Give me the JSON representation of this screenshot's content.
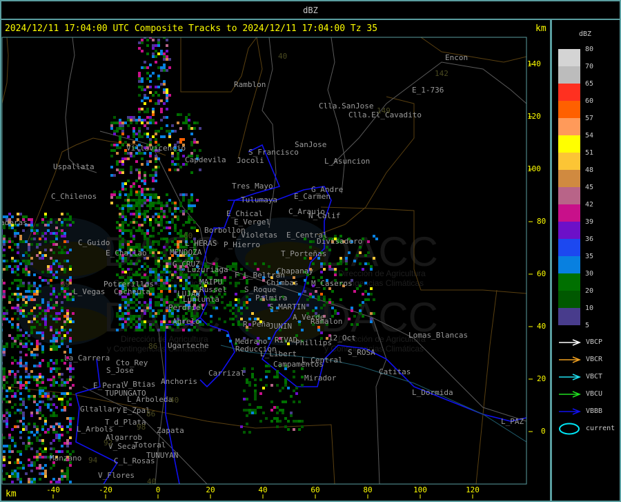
{
  "header": {
    "title": "dBZ"
  },
  "plot": {
    "title": "2024/12/11 17:04:00 UTC Composite Tracks to 2024/12/11 17:04:00 Tz 35",
    "y_unit": "km",
    "x_unit": "km",
    "x_ticks": [
      "-40",
      "-20",
      "0",
      "20",
      "40",
      "60",
      "80",
      "100",
      "120"
    ],
    "y_ticks": [
      "140",
      "120",
      "100",
      "80",
      "60",
      "40",
      "20",
      "0"
    ],
    "watermark": [
      "DACC",
      "Dirección de Agricultura",
      "y Contingencias Climáticas",
      "http://www.contingencias.mendoza.gov.ar"
    ]
  },
  "places": [
    "Ramblon",
    "Encon",
    "E_1-736",
    "Clla.SanJose",
    "Clla.El_Cavadito",
    "SanJose",
    "S_Francisco",
    "Jocoli",
    "L_Asuncion",
    "Villavicencio",
    "Capdevila",
    "Uspallata",
    "C_Chilenos",
    "Tres_Mayo",
    "G_Andre",
    "E_Carmen",
    "Tulumaya",
    "C_Araujo",
    "N_Calif",
    "E_Chical",
    "E_Vergel",
    "Borbollon",
    "L_Violetas",
    "E_Central",
    "Divisadero",
    "P_Hierro",
    "L_HERAS",
    "C_Guido",
    "E_Challao",
    "MENDOZA",
    "T_Porteñas",
    "G_CRUZ",
    "Luzuriaga",
    "Chapanay",
    "F_L_Beltran",
    "Potrerillos",
    "MAIPU",
    "Chimbas",
    "M_Caseros",
    "L_Vegas",
    "Cacheuta",
    "Russel",
    "S_Roque",
    "LUJAN",
    "Lunlunta",
    "Palmira",
    "S_MARTIN",
    "Perdriel",
    "A_Verde",
    "Ramalon",
    "Agrelo",
    "R_Peña",
    "JUNIN",
    "12_Oct",
    "Lomas_Blancas",
    "Medrano",
    "RIVAD",
    "Phillips",
    "Ugarteche",
    "Reduccion",
    "L_Libert",
    "S_ROSA",
    "La_Carrera",
    "Cto_Rey",
    "L_Central",
    "Campamentos",
    "S_Jose",
    "Carrizal",
    "Anchoris",
    "Catitas",
    "Mirador",
    "E_Peral",
    "V_Btias",
    "TUPUNGATO",
    "L_Dormida",
    "L_Arboleda",
    "Gltallary",
    "E_Zpal",
    "T_d_Plata",
    "L_Arbols",
    "Zapata",
    "L_PAZ",
    "Algarrob",
    "V_Seca",
    "Totoral",
    "Manzano",
    "C_L_Rosas",
    "TUNUYAN",
    "V_Flores",
    "aderas"
  ],
  "road_numbers": [
    "40",
    "142",
    "149",
    "7",
    "60",
    "89",
    "86",
    "40",
    "86",
    "98",
    "92",
    "94",
    "40"
  ],
  "legend": {
    "title": "dBZ",
    "scale": [
      {
        "label": "80",
        "color": "#d4d4d4"
      },
      {
        "label": "70",
        "color": "#bcbcbc"
      },
      {
        "label": "65",
        "color": "#ff3020"
      },
      {
        "label": "60",
        "color": "#ff6000"
      },
      {
        "label": "57",
        "color": "#ff9a5a"
      },
      {
        "label": "54",
        "color": "#ffff00"
      },
      {
        "label": "51",
        "color": "#fcc535"
      },
      {
        "label": "48",
        "color": "#d08a40"
      },
      {
        "label": "45",
        "color": "#b86488"
      },
      {
        "label": "42",
        "color": "#c8108a"
      },
      {
        "label": "39",
        "color": "#6c10c8"
      },
      {
        "label": "36",
        "color": "#1c48f0"
      },
      {
        "label": "35",
        "color": "#0880e0"
      },
      {
        "label": "30",
        "color": "#007000"
      },
      {
        "label": "20",
        "color": "#005800"
      },
      {
        "label": "10",
        "color": "#483c8c"
      }
    ],
    "bottom_label": "5",
    "tracks": [
      {
        "label": "VBCP",
        "color": "#ffffff"
      },
      {
        "label": "VBCR",
        "color": "#f0a020"
      },
      {
        "label": "VBCT",
        "color": "#20e0f0"
      },
      {
        "label": "VBCU",
        "color": "#20e020"
      },
      {
        "label": "VBBB",
        "color": "#1010f0"
      }
    ],
    "current": {
      "label": "current",
      "color": "#00e8f8"
    }
  },
  "colors": {
    "frame": "#5a9ea0",
    "axis": "#ffff00",
    "place_text": "#9a9a9a",
    "roads": "#5a5a5a",
    "boundaries": "#5a4010",
    "rivers": "#1010f0"
  }
}
